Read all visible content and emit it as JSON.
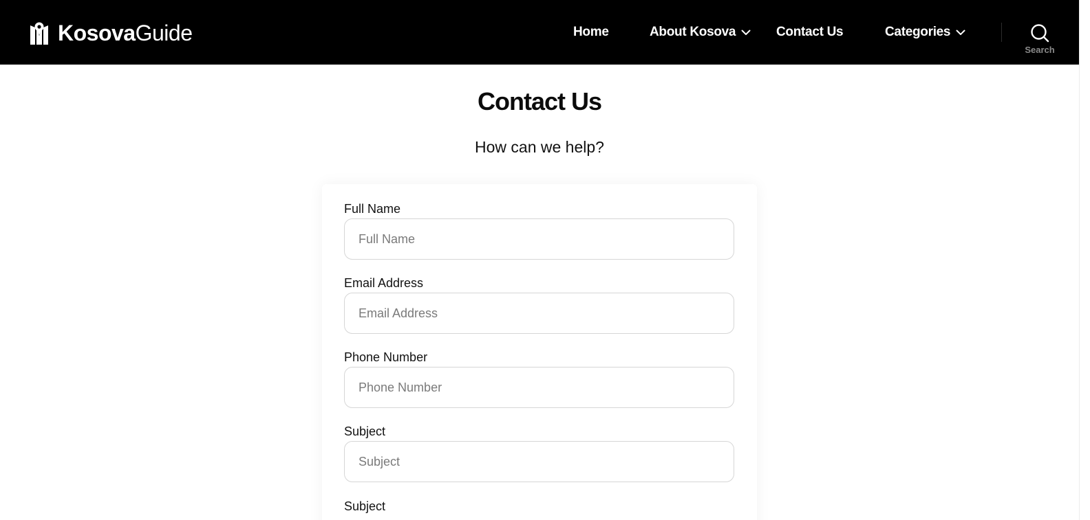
{
  "header": {
    "logo": {
      "bold": "Kosova",
      "light": "Guide"
    },
    "nav": [
      {
        "label": "Home",
        "dropdown": false
      },
      {
        "label": "About Kosova",
        "dropdown": true
      },
      {
        "label": "Contact Us",
        "dropdown": false
      },
      {
        "label": "Categories",
        "dropdown": true
      }
    ],
    "search_label": "Search"
  },
  "main": {
    "title": "Contact Us",
    "subtitle": "How can we help?"
  },
  "form": {
    "fields": [
      {
        "label": "Full Name",
        "placeholder": "Full Name",
        "value": ""
      },
      {
        "label": "Email Address",
        "placeholder": "Email Address",
        "value": ""
      },
      {
        "label": "Phone Number",
        "placeholder": "Phone Number",
        "value": ""
      },
      {
        "label": "Subject",
        "placeholder": "Subject",
        "value": ""
      }
    ],
    "next_label": "Subject"
  },
  "colors": {
    "header_bg": "#000000",
    "page_bg": "#ffffff",
    "input_border": "#d6d6d6",
    "search_label": "#8a8a8a"
  },
  "icons": [
    "logo-map-pin-icon",
    "chevron-down-icon",
    "search-icon"
  ]
}
